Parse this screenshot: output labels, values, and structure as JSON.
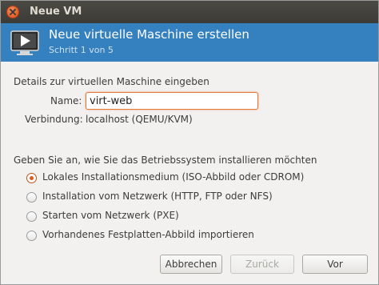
{
  "window": {
    "title": "Neue VM"
  },
  "banner": {
    "heading": "Neue virtuelle Maschine erstellen",
    "step": "Schritt 1 von 5",
    "icon": "vm-play-icon"
  },
  "details": {
    "section_label": "Details zur virtuellen Maschine eingeben",
    "name_label": "Name:",
    "name_value": "virt-web",
    "connection_label": "Verbindung:",
    "connection_value": "localhost (QEMU/KVM)"
  },
  "install": {
    "prompt": "Geben Sie an, wie Sie das Betriebssystem installieren möchten",
    "options": [
      {
        "label": "Lokales Installationsmedium (ISO-Abbild oder CDROM)",
        "selected": true
      },
      {
        "label": "Installation vom Netzwerk (HTTP, FTP oder NFS)",
        "selected": false
      },
      {
        "label": "Starten vom Netzwerk (PXE)",
        "selected": false
      },
      {
        "label": "Vorhandenes Festplatten-Abbild importieren",
        "selected": false
      }
    ]
  },
  "buttons": {
    "cancel": "Abbrechen",
    "back": "Zurück",
    "forward": "Vor"
  },
  "colors": {
    "banner": "#3580bf",
    "focus_border": "#e07a3c",
    "radio_selected": "#e05a20"
  }
}
